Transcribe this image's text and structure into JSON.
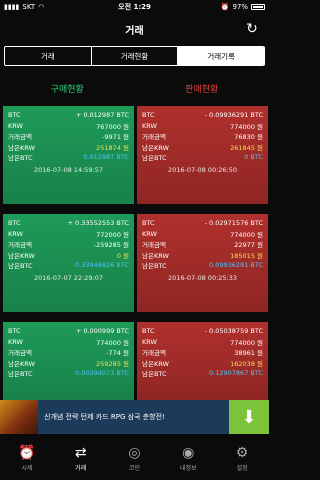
{
  "status_bar": {
    "carrier": "SKT",
    "time": "오전 1:29",
    "battery": "97%"
  },
  "header": {
    "title": "거래"
  },
  "tabs": [
    {
      "label": "거래"
    },
    {
      "label": "거래현황"
    },
    {
      "label": "거래기록"
    }
  ],
  "sections": {
    "buy": "구매현황",
    "sell": "판매현황"
  },
  "buy_cards": [
    {
      "rows": [
        {
          "k": "BTC",
          "v": "+ 0.012987 BTC"
        },
        {
          "k": "KRW",
          "v": "767000 원"
        },
        {
          "k": "거래금액",
          "v": "-9971 원"
        },
        {
          "k": "남은KRW",
          "v": "251874 원"
        },
        {
          "k": "남은BTC",
          "v": "0.012987 BTC"
        }
      ],
      "date": "2016-07-08 14:59:57"
    },
    {
      "rows": [
        {
          "k": "BTC",
          "v": "+ 0.33552553 BTC"
        },
        {
          "k": "KRW",
          "v": "772000 원"
        },
        {
          "k": "거래금액",
          "v": "-259285 원"
        },
        {
          "k": "남은KRW",
          "v": "0 원"
        },
        {
          "k": "남은BTC",
          "v": "0.33946826 BTC"
        }
      ],
      "date": "2016-07-07 22:29:07"
    },
    {
      "rows": [
        {
          "k": "BTC",
          "v": "+ 0.000999 BTC"
        },
        {
          "k": "KRW",
          "v": "774000 원"
        },
        {
          "k": "거래금액",
          "v": "-774 원"
        },
        {
          "k": "남은KRW",
          "v": "259285 원"
        },
        {
          "k": "남은BTC",
          "v": "0.00394073 BTC"
        }
      ],
      "date": ""
    }
  ],
  "sell_cards": [
    {
      "rows": [
        {
          "k": "BTC",
          "v": "- 0.09936291 BTC"
        },
        {
          "k": "KRW",
          "v": "774000 원"
        },
        {
          "k": "거래금액",
          "v": "76830 원"
        },
        {
          "k": "남은KRW",
          "v": "261845 원"
        },
        {
          "k": "남은BTC",
          "v": "0 BTC"
        }
      ],
      "date": "2016-07-08 00:26:50"
    },
    {
      "rows": [
        {
          "k": "BTC",
          "v": "- 0.02971576 BTC"
        },
        {
          "k": "KRW",
          "v": "774000 원"
        },
        {
          "k": "거래금액",
          "v": "22977 원"
        },
        {
          "k": "남은KRW",
          "v": "185015 원"
        },
        {
          "k": "남은BTC",
          "v": "0.09936291 BTC"
        }
      ],
      "date": "2016-07-08 00:25:33"
    },
    {
      "rows": [
        {
          "k": "BTC",
          "v": "- 0.05038759 BTC"
        },
        {
          "k": "KRW",
          "v": "774000 원"
        },
        {
          "k": "거래금액",
          "v": "38961 원"
        },
        {
          "k": "남은KRW",
          "v": "162038 원"
        },
        {
          "k": "남은BTC",
          "v": "0.12907867 BTC"
        }
      ],
      "date": ""
    }
  ],
  "ad": {
    "text": "신개념 전략 턴제 카드 RPG 삼국 춘향전!"
  },
  "bottom_tabs": [
    {
      "label": "시세",
      "icon": "alarm-clock-icon"
    },
    {
      "label": "거래",
      "icon": "swap-arrows-icon"
    },
    {
      "label": "코인",
      "icon": "coin-icon"
    },
    {
      "label": "내정보",
      "icon": "user-icon"
    },
    {
      "label": "설정",
      "icon": "gear-icon"
    }
  ],
  "colors": {
    "buy": "#33d17a",
    "sell": "#e0403a",
    "yellow_value": "#f4e04d",
    "cyan_value": "#4fc3f7"
  }
}
